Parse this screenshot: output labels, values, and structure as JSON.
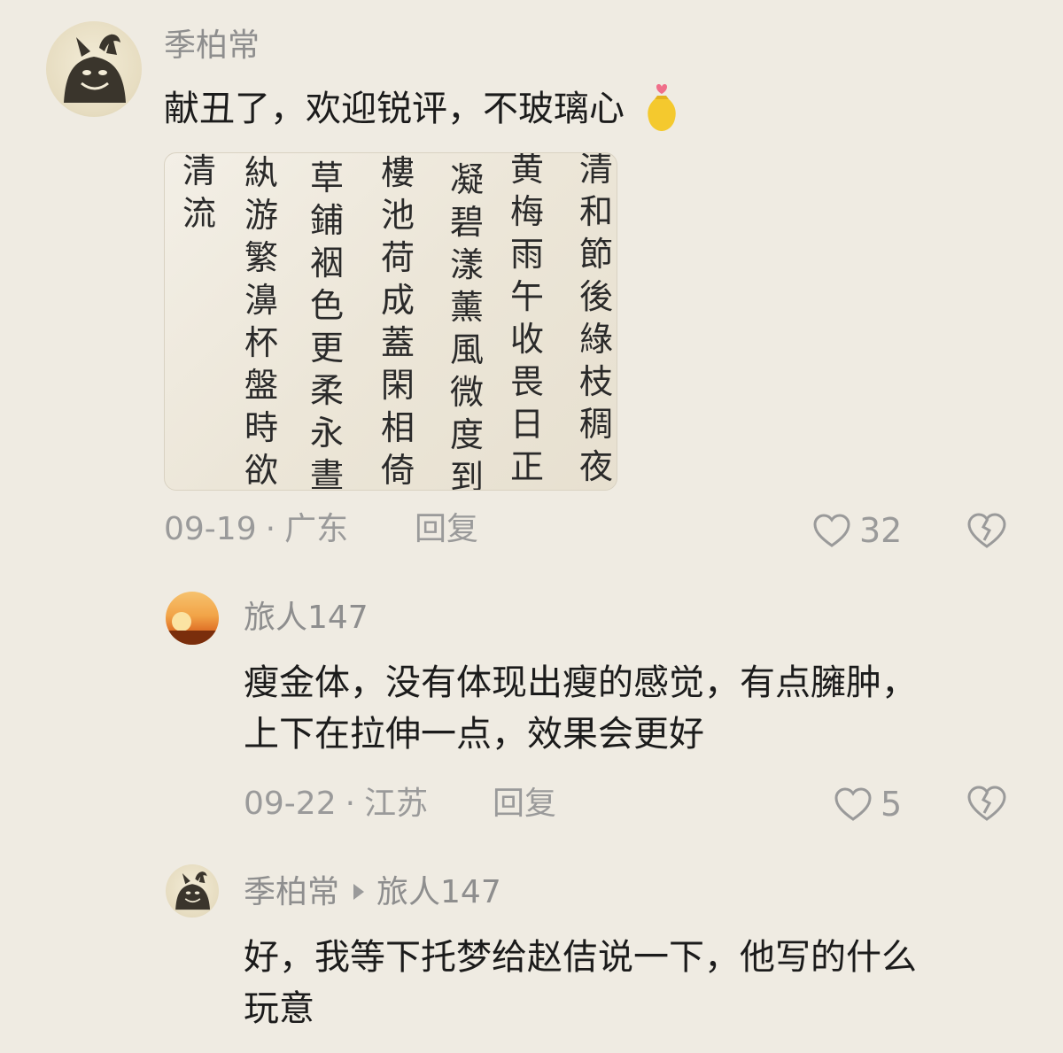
{
  "comments": [
    {
      "user": "季柏常",
      "text": "献丑了，欢迎锐评，不玻璃心",
      "emoji_icon": "gold-bag-heart-icon",
      "date": "09-19",
      "location": "广东",
      "reply_label": "回复",
      "likes": "32"
    },
    {
      "user": "旅人147",
      "text_lines": [
        "瘦金体，没有体现出瘦的感觉，有点臃肿，",
        "上下在拉伸一点，效果会更好"
      ],
      "date": "09-22",
      "location": "江苏",
      "reply_label": "回复",
      "likes": "5"
    },
    {
      "user": "季柏常",
      "reply_to": "旅人147",
      "text_lines": [
        "好，我等下托梦给赵佶说一下，他写的什么",
        "玩意"
      ]
    }
  ],
  "calligraphy": {
    "columns": [
      "清和節後綠枝稠夜",
      "黄梅雨午收畏日正長",
      "凝碧漾薰風微度到",
      "樓池荷成蓋閑相倚滿",
      "草鋪裀色更柔永晝",
      "紈游繁濞杯盤時欲對",
      "清流"
    ]
  },
  "colors": {
    "background": "#efebe2",
    "username": "#8e8e8e",
    "meta": "#9a9a9a",
    "text": "#1b1b1b"
  }
}
